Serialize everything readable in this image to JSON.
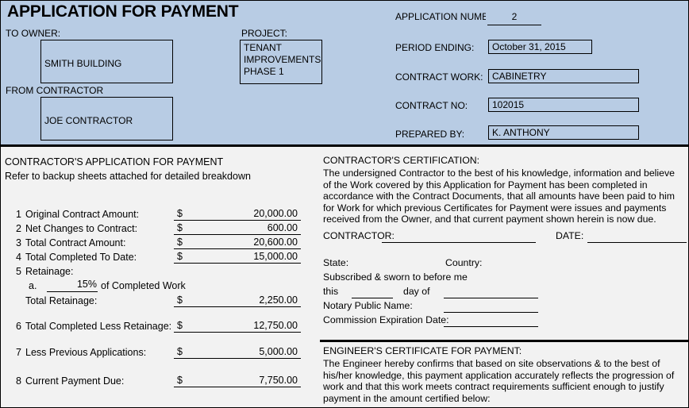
{
  "document": {
    "title": "APPLICATION FOR PAYMENT",
    "header_bg": "#b8cce4",
    "body_bg": "#f2f2f2"
  },
  "header": {
    "to_owner_label": "TO OWNER:",
    "to_owner_value": "SMITH BUILDING",
    "from_contractor_label": "FROM CONTRACTOR",
    "from_contractor_value": "JOE CONTRACTOR",
    "project_label": "PROJECT:",
    "project_value": "TENANT\nIMPROVEMENTS\nPHASE 1",
    "project_line1": "TENANT",
    "project_line2": "IMPROVEMENTS",
    "project_line3": "PHASE 1",
    "application_number_label": "APPLICATION NUMBER",
    "application_number_value": "2",
    "period_ending_label": "PERIOD ENDING:",
    "period_ending_value": "October 31, 2015",
    "contract_work_label": "CONTRACT WORK:",
    "contract_work_value": "CABINETRY",
    "contract_no_label": "CONTRACT NO:",
    "contract_no_value": "102015",
    "prepared_by_label": "PREPARED BY:",
    "prepared_by_value": "K. ANTHONY"
  },
  "left": {
    "section_title": "CONTRACTOR'S APPLICATION FOR PAYMENT",
    "note": "Refer to backup sheets attached for detailed breakdown",
    "currency_symbol": "$",
    "items": [
      {
        "num": "1",
        "label": "Original Contract Amount:",
        "value": "20,000.00"
      },
      {
        "num": "2",
        "label": "Net Changes to Contract:",
        "value": "600.00"
      },
      {
        "num": "3",
        "label": "Total Contract Amount:",
        "value": "20,600.00"
      },
      {
        "num": "4",
        "label": "Total Completed To Date:",
        "value": "15,000.00"
      }
    ],
    "retainage": {
      "num": "5",
      "label": "Retainage:",
      "sub_letter": "a.",
      "percent": "15%",
      "percent_suffix": "of Completed Work",
      "total_label": "Total Retainage:",
      "total_value": "2,250.00"
    },
    "items_lower": [
      {
        "num": "6",
        "label": "Total Completed Less Retainage:",
        "value": "12,750.00"
      },
      {
        "num": "7",
        "label": "Less Previous Applications:",
        "value": "5,000.00"
      },
      {
        "num": "8",
        "label": "Current Payment Due:",
        "value": "7,750.00"
      }
    ]
  },
  "right": {
    "certification_title": "CONTRACTOR'S CERTIFICATION:",
    "certification_body": "The undersigned Contractor to the best of his knowledge, information and believe of the Work covered by this Application for Payment has been completed in accordance with the Contract Documents, that all amounts have been paid to him for Work for which previous Certificates for Payment were issues and payments received from the Owner, and that current payment shown herein is now due.",
    "contractor_label": "CONTRACTOR:",
    "date_label": "DATE:",
    "state_label": "State:",
    "country_label": "Country:",
    "subscribed_label": "Subscribed & sworn to before me",
    "this_label": "this",
    "day_of_label": "day of",
    "notary_name_label": "Notary Public Name:",
    "commission_label": "Commission Expiration Date:",
    "engineer_title": "ENGINEER'S CERTIFICATE FOR PAYMENT:",
    "engineer_body": "The Engineer hereby confirms that based on site observations & to the best of his/her knowledge, this payment application accurately reflects the progression of work and that this work meets contract requirements sufficient enough to justify payment in the amount certified below:"
  }
}
